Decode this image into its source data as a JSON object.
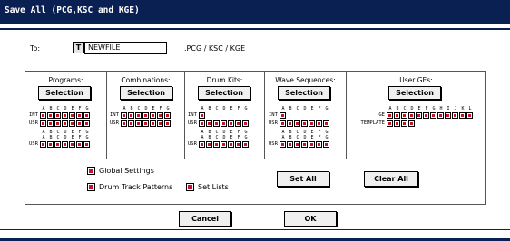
{
  "dialog": {
    "title": "Save All (PCG,KSC and KGE)"
  },
  "to": {
    "label": "To:",
    "text_button": "T",
    "filename": "NEWFILE",
    "extensions": ".PCG / KSC / KGE"
  },
  "columns": [
    {
      "title": "Programs:",
      "button": "Selection",
      "groups": [
        {
          "letters": [
            "A",
            "B",
            "C",
            "D",
            "E",
            "F",
            "G"
          ],
          "rows": [
            {
              "label": "INT",
              "count": 7
            },
            {
              "label": "USR",
              "count": 7
            }
          ]
        },
        {
          "letters": [
            "A",
            "B",
            "C",
            "D",
            "E",
            "F",
            "G"
          ],
          "letters2": [
            "A",
            "B",
            "C",
            "D",
            "E",
            "F",
            "G"
          ],
          "rows": [
            {
              "label": "USR",
              "count": 7
            }
          ]
        }
      ]
    },
    {
      "title": "Combinations:",
      "button": "Selection",
      "groups": [
        {
          "letters": [
            "A",
            "B",
            "C",
            "D",
            "E",
            "F",
            "G"
          ],
          "rows": [
            {
              "label": "INT",
              "count": 7
            },
            {
              "label": "USR",
              "count": 7
            }
          ]
        }
      ]
    },
    {
      "title": "Drum Kits:",
      "button": "Selection",
      "groups": [
        {
          "letters": [
            "A",
            "B",
            "C",
            "D",
            "E",
            "F",
            "G"
          ],
          "rows": [
            {
              "label": "INT",
              "count": 1
            },
            {
              "label": "USR",
              "count": 7
            }
          ]
        },
        {
          "letters": [
            "A",
            "B",
            "C",
            "D",
            "E",
            "F",
            "G"
          ],
          "letters2": [
            "A",
            "B",
            "C",
            "D",
            "E",
            "F",
            "G"
          ],
          "rows": [
            {
              "label": "USR",
              "count": 7
            }
          ]
        }
      ]
    },
    {
      "title": "Wave Sequences:",
      "button": "Selection",
      "groups": [
        {
          "letters": [
            "A",
            "B",
            "C",
            "D",
            "E",
            "F",
            "G"
          ],
          "rows": [
            {
              "label": "INT",
              "count": 1
            },
            {
              "label": "USR",
              "count": 7
            }
          ]
        },
        {
          "letters": [
            "A",
            "B",
            "C",
            "D",
            "E",
            "F",
            "G"
          ],
          "letters2": [
            "A",
            "B",
            "C",
            "D",
            "E",
            "F",
            "G"
          ],
          "rows": [
            {
              "label": "USR",
              "count": 7
            }
          ]
        }
      ]
    },
    {
      "title": "User GEs:",
      "button": "Selection",
      "groups": [
        {
          "letters": [
            "A",
            "B",
            "C",
            "D",
            "E",
            "F",
            "G",
            "H",
            "I",
            "J",
            "K",
            "L"
          ],
          "rows": [
            {
              "label": "GE",
              "count": 12
            },
            {
              "label": "TEMPLATE",
              "count": 4
            }
          ]
        }
      ]
    }
  ],
  "options": {
    "global_settings": "Global Settings",
    "drum_track_patterns": "Drum Track Patterns",
    "set_lists": "Set Lists"
  },
  "buttons": {
    "set_all": "Set All",
    "clear_all": "Clear All",
    "cancel": "Cancel",
    "ok": "OK"
  },
  "colors": {
    "titlebar": "#0a1f52",
    "checked": "#c0152a"
  }
}
